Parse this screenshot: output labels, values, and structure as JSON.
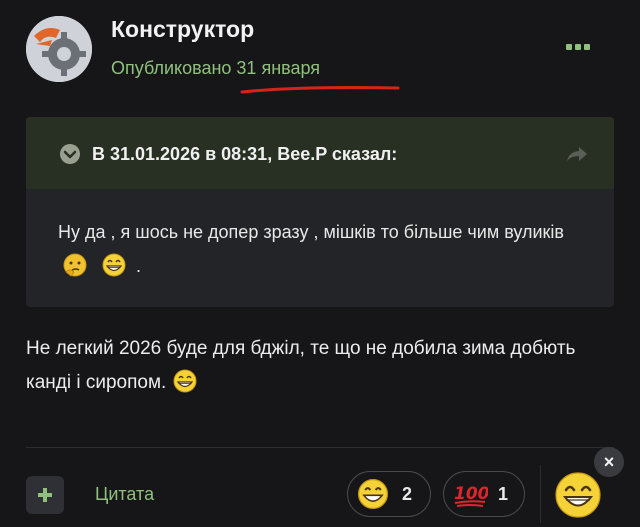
{
  "post": {
    "author": "Конструктор",
    "published": "Опубликовано 31 января",
    "more_icon": "more-dots-icon"
  },
  "quote": {
    "citation": "В 31.01.2026 в 08:31, Bee.P сказал:",
    "text": "Ну да , я шось не допер зразу , мішків то більше чим вуликів",
    "trailing": "."
  },
  "body": {
    "text": "Не легкий 2026 буде для бджіл, те що не добила зима добють канді і сиропом."
  },
  "actions": {
    "quote_label": "Цитата",
    "add_icon": "plus-icon"
  },
  "reactions": [
    {
      "icon": "grinning-face-icon",
      "count": "2"
    },
    {
      "icon": "hundred-points-icon",
      "count": "1"
    }
  ],
  "close_label": "×",
  "colors": {
    "accent": "#8fc17d",
    "background": "#161618",
    "quote_bg": "#232427",
    "quote_header": "#283023",
    "underline": "#d8231c"
  }
}
